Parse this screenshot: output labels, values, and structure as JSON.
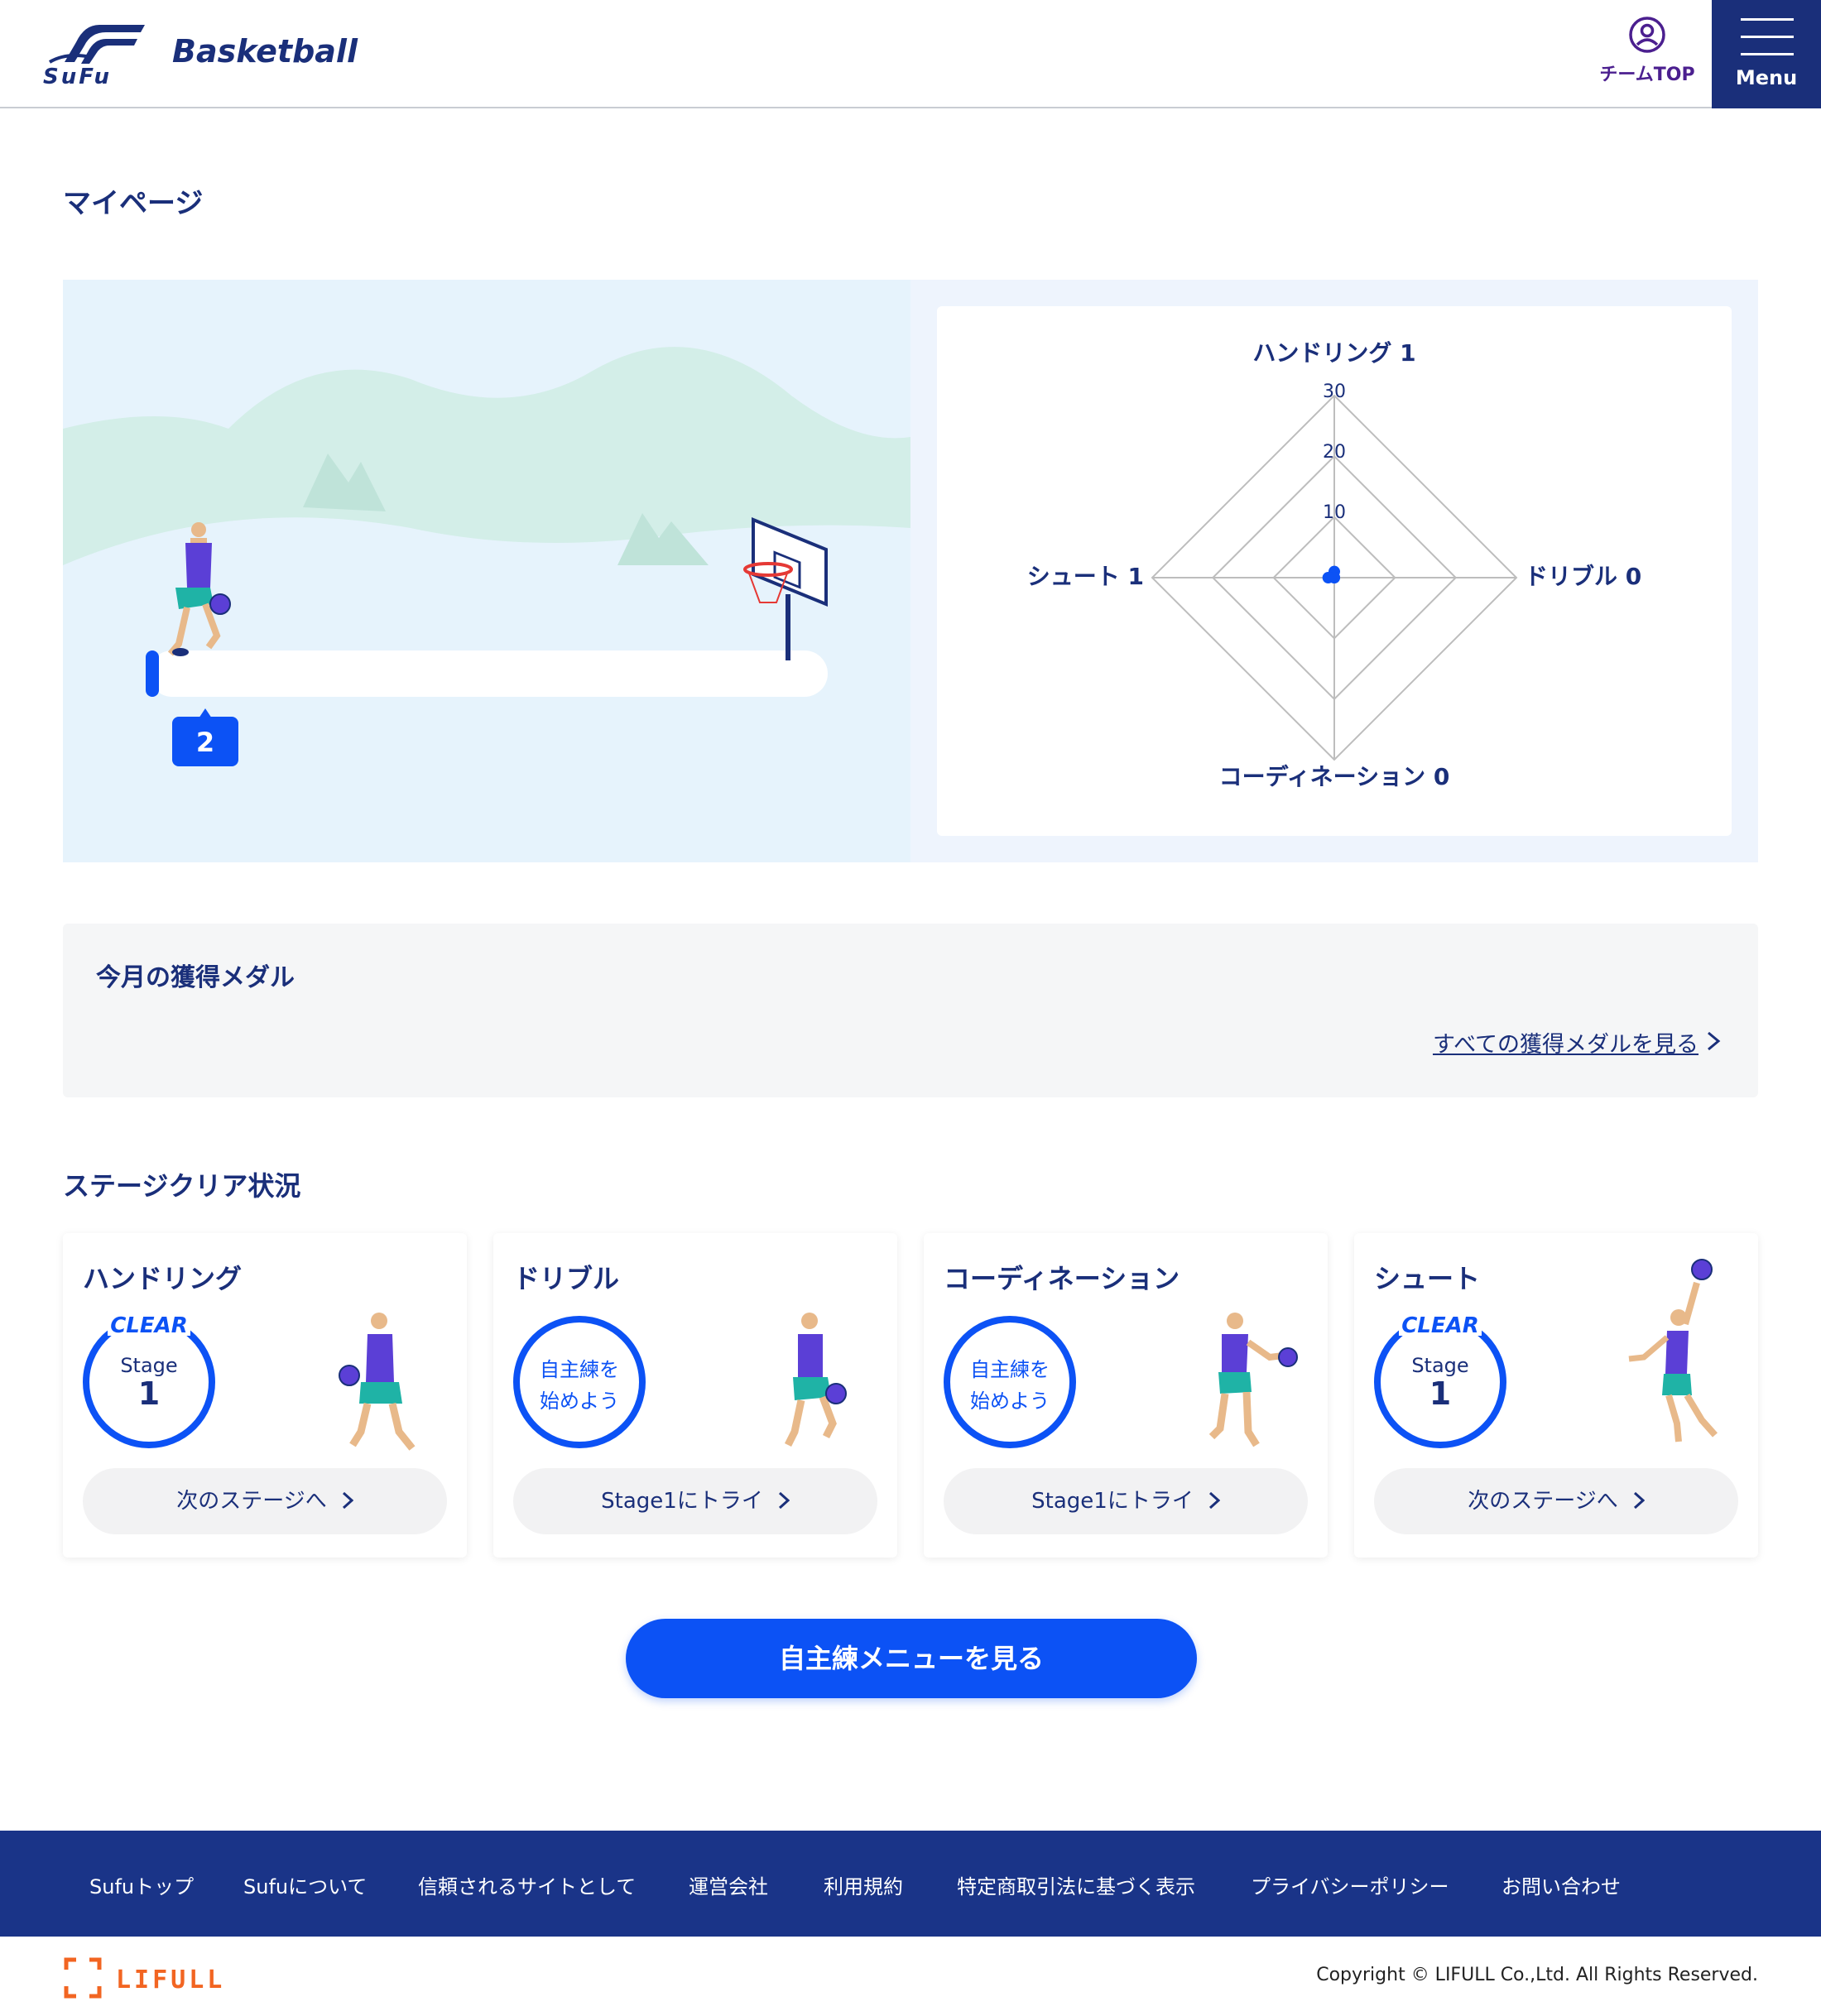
{
  "header": {
    "logo_text": "SuFu",
    "sport": "Basketball",
    "team_top_label": "チームTOP",
    "menu_label": "Menu"
  },
  "page_title": "マイページ",
  "progress": {
    "stage_badge": "2"
  },
  "radar": {
    "labels": {
      "handling": "ハンドリング 1",
      "dribble": "ドリブル 0",
      "coordination": "コーディネーション 0",
      "shoot": "シュート 1"
    },
    "ticks": [
      "10",
      "20",
      "30"
    ]
  },
  "chart_data": {
    "type": "radar",
    "axes": [
      "ハンドリング",
      "ドリブル",
      "コーディネーション",
      "シュート"
    ],
    "values": [
      1,
      0,
      0,
      1
    ],
    "rlim": [
      0,
      30
    ],
    "ticks": [
      10,
      20,
      30
    ]
  },
  "medals": {
    "title": "今月の獲得メダル",
    "link": "すべての獲得メダルを見る"
  },
  "stage_section_title": "ステージクリア状況",
  "stages": [
    {
      "title": "ハンドリング",
      "status": "clear",
      "clear_text": "CLEAR",
      "stage_label": "Stage",
      "stage_num": "1",
      "button": "次のステージへ"
    },
    {
      "title": "ドリブル",
      "status": "start",
      "msg1": "自主練を",
      "msg2": "始めよう",
      "button": "Stage1にトライ"
    },
    {
      "title": "コーディネーション",
      "status": "start",
      "msg1": "自主練を",
      "msg2": "始めよう",
      "button": "Stage1にトライ"
    },
    {
      "title": "シュート",
      "status": "clear",
      "clear_text": "CLEAR",
      "stage_label": "Stage",
      "stage_num": "1",
      "button": "次のステージへ"
    }
  ],
  "cta": "自主練メニューを見る",
  "footer": {
    "links": [
      "Sufuトップ",
      "Sufuについて",
      "信頼されるサイトとして",
      "運営会社",
      "利用規約",
      "特定商取引法に基づく表示",
      "プライバシーポリシー",
      "お問い合わせ"
    ],
    "brand": "LIFULL",
    "copyright": "Copyright © LIFULL Co.,Ltd. All Rights Reserved."
  },
  "colors": {
    "navy": "#1a2f7a",
    "blue": "#0c52f5",
    "footer": "#1a3488",
    "orange": "#f26522"
  }
}
